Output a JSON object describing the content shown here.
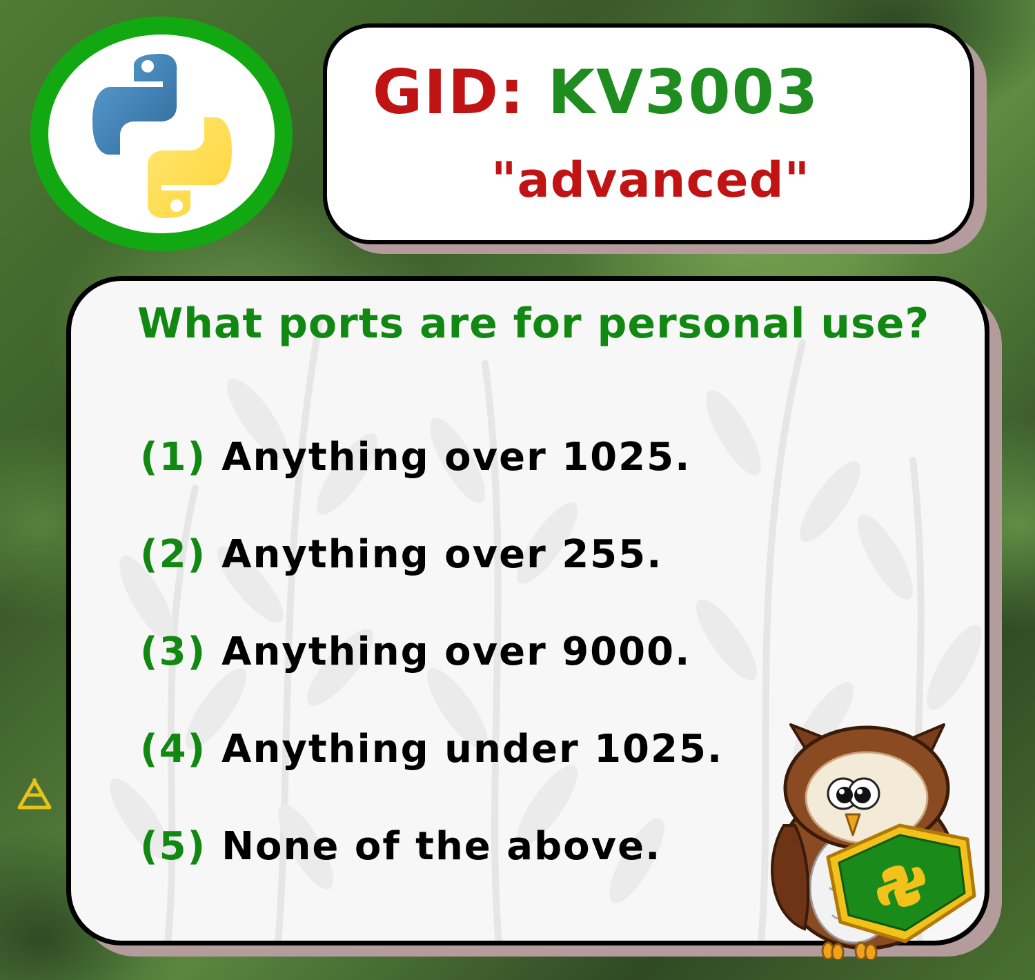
{
  "header": {
    "gid_label": "GID:",
    "gid_value": "KV3003",
    "level": "\"advanced\""
  },
  "question": "What ports are for personal use?",
  "options": [
    {
      "num": "(1)",
      "text": "Anything over 1025."
    },
    {
      "num": "(2)",
      "text": "Anything over 255."
    },
    {
      "num": "(3)",
      "text": "Anything over 9000."
    },
    {
      "num": "(4)",
      "text": "Anything under 1025."
    },
    {
      "num": "(5)",
      "text": "None of the above."
    }
  ],
  "icons": {
    "logo": "python-logo-icon",
    "mascot": "owl-mascot-icon",
    "badge": "python-shield-icon",
    "side": "triangle-mark-icon"
  },
  "colors": {
    "logo_ring": "#12a812",
    "gid_label": "#c01414",
    "gid_value": "#1f8c1f",
    "level": "#c01414",
    "question": "#118811",
    "option_number": "#118811",
    "option_text": "#000000"
  }
}
